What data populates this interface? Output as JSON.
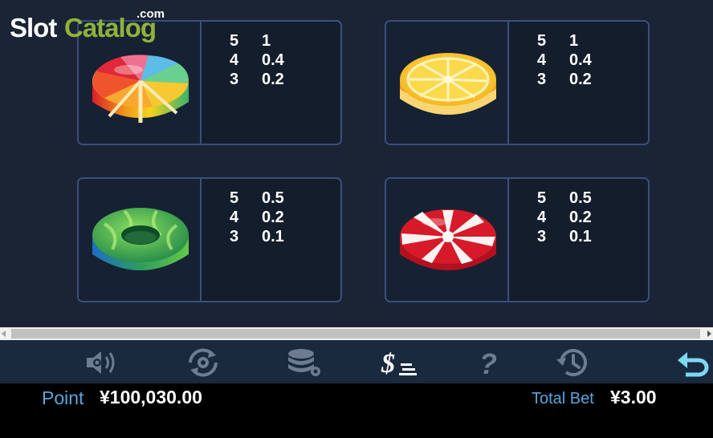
{
  "logo": {
    "brand_part1": "Slot",
    "brand_part2": "Catalog",
    "suffix": ".com"
  },
  "paytable": {
    "cards": [
      {
        "symbol": "rainbow-candy-icon",
        "pays": [
          {
            "count": "5",
            "mult": "1"
          },
          {
            "count": "4",
            "mult": "0.4"
          },
          {
            "count": "3",
            "mult": "0.2"
          }
        ]
      },
      {
        "symbol": "lemon-candy-icon",
        "pays": [
          {
            "count": "5",
            "mult": "1"
          },
          {
            "count": "4",
            "mult": "0.4"
          },
          {
            "count": "3",
            "mult": "0.2"
          }
        ]
      },
      {
        "symbol": "green-ring-candy-icon",
        "pays": [
          {
            "count": "5",
            "mult": "0.5"
          },
          {
            "count": "4",
            "mult": "0.2"
          },
          {
            "count": "3",
            "mult": "0.1"
          }
        ]
      },
      {
        "symbol": "peppermint-candy-icon",
        "pays": [
          {
            "count": "5",
            "mult": "0.5"
          },
          {
            "count": "4",
            "mult": "0.2"
          },
          {
            "count": "3",
            "mult": "0.1"
          }
        ]
      }
    ]
  },
  "toolbar": {
    "icons": [
      "sound-settings-icon",
      "autoplay-settings-icon",
      "chips-settings-icon",
      "paytable-icon",
      "help-icon",
      "history-icon",
      "back-icon"
    ]
  },
  "status": {
    "point_label": "Point",
    "point_value": "¥100,030.00",
    "bet_label": "Total Bet",
    "bet_value": "¥3.00"
  },
  "colors": {
    "panel_border": "#3b4f7d",
    "panel_bg": "#131d2b",
    "accent_blue": "#5aa6dc",
    "logo_green": "#8fb33a",
    "active_icon": "#ffffff",
    "inactive_icon": "#6d7c8f"
  }
}
